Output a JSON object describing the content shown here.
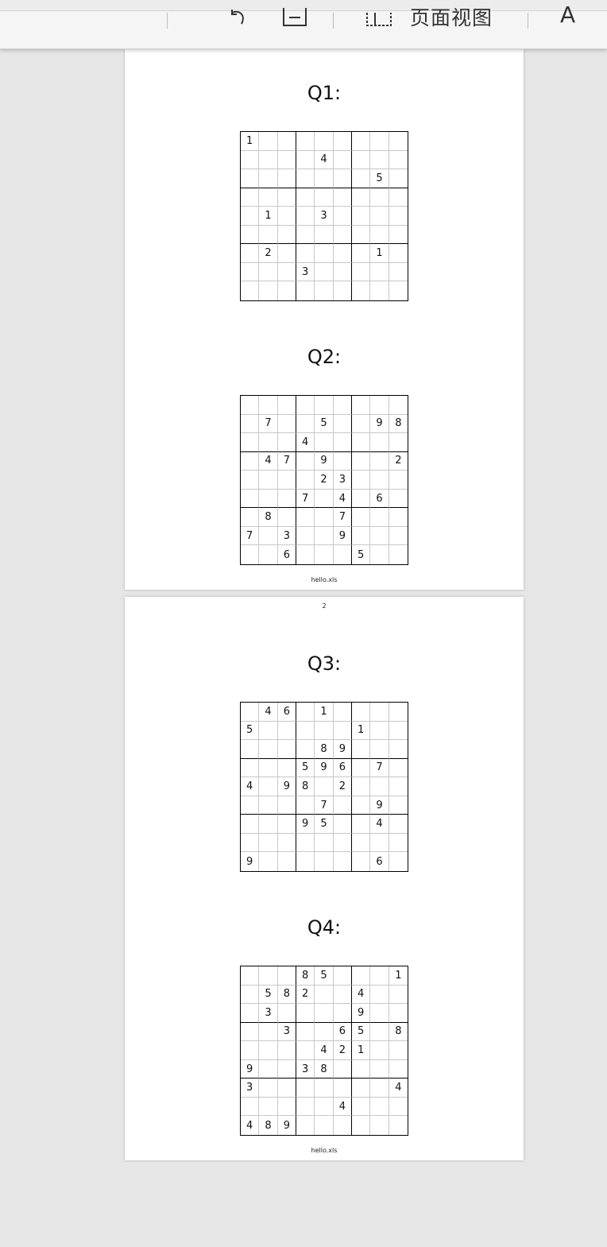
{
  "toolbar": {
    "page_view_label": "页面视图",
    "font_label": "A"
  },
  "page1": {
    "puzzles": [
      {
        "title": "Q1:",
        "grid": [
          [
            "1",
            "",
            "",
            "",
            "",
            "",
            "",
            "",
            ""
          ],
          [
            "",
            "",
            "",
            "",
            "4",
            "",
            "",
            "",
            ""
          ],
          [
            "",
            "",
            "",
            "",
            "",
            "",
            "",
            "5",
            ""
          ],
          [
            "",
            "",
            "",
            "",
            "",
            "",
            "",
            "",
            ""
          ],
          [
            "",
            "1",
            "",
            "",
            "3",
            "",
            "",
            "",
            ""
          ],
          [
            "",
            "",
            "",
            "",
            "",
            "",
            "",
            "",
            ""
          ],
          [
            "",
            "2",
            "",
            "",
            "",
            "",
            "",
            "1",
            ""
          ],
          [
            "",
            "",
            "",
            "3",
            "",
            "",
            "",
            "",
            ""
          ],
          [
            "",
            "",
            "",
            "",
            "",
            "",
            "",
            "",
            ""
          ]
        ]
      },
      {
        "title": "Q2:",
        "grid": [
          [
            "",
            "",
            "",
            "",
            "",
            "",
            "",
            "",
            ""
          ],
          [
            "",
            "7",
            "",
            "",
            "5",
            "",
            "",
            "9",
            "8"
          ],
          [
            "",
            "",
            "",
            "4",
            "",
            "",
            "",
            "",
            ""
          ],
          [
            "",
            "4",
            "7",
            "",
            "9",
            "",
            "",
            "",
            "2"
          ],
          [
            "",
            "",
            "",
            "",
            "2",
            "3",
            "",
            "",
            ""
          ],
          [
            "",
            "",
            "",
            "7",
            "",
            "4",
            "",
            "6",
            ""
          ],
          [
            "",
            "8",
            "",
            "",
            "",
            "7",
            "",
            "",
            ""
          ],
          [
            "7",
            "",
            "3",
            "",
            "",
            "9",
            "",
            "",
            ""
          ],
          [
            "",
            "",
            "6",
            "",
            "",
            "",
            "5",
            "",
            ""
          ]
        ]
      }
    ],
    "footer": "hello.xls"
  },
  "page2": {
    "page_number": "2",
    "puzzles": [
      {
        "title": "Q3:",
        "grid": [
          [
            "",
            "4",
            "6",
            "",
            "1",
            "",
            "",
            "",
            ""
          ],
          [
            "5",
            "",
            "",
            "",
            "",
            "",
            "1",
            "",
            ""
          ],
          [
            "",
            "",
            "",
            "",
            "8",
            "9",
            "",
            "",
            ""
          ],
          [
            "",
            "",
            "",
            "5",
            "9",
            "6",
            "",
            "7",
            ""
          ],
          [
            "4",
            "",
            "9",
            "8",
            "",
            "2",
            "",
            "",
            ""
          ],
          [
            "",
            "",
            "",
            "",
            "7",
            "",
            "",
            "9",
            ""
          ],
          [
            "",
            "",
            "",
            "9",
            "5",
            "",
            "",
            "4",
            ""
          ],
          [
            "",
            "",
            "",
            "",
            "",
            "",
            "",
            "",
            ""
          ],
          [
            "9",
            "",
            "",
            "",
            "",
            "",
            "",
            "6",
            ""
          ]
        ]
      },
      {
        "title": "Q4:",
        "grid": [
          [
            "",
            "",
            "",
            "8",
            "5",
            "",
            "",
            "",
            "1"
          ],
          [
            "",
            "5",
            "8",
            "2",
            "",
            "",
            "4",
            "",
            ""
          ],
          [
            "",
            "3",
            "",
            "",
            "",
            "",
            "9",
            "",
            ""
          ],
          [
            "",
            "",
            "3",
            "",
            "",
            "6",
            "5",
            "",
            "8"
          ],
          [
            "",
            "",
            "",
            "",
            "4",
            "2",
            "1",
            "",
            ""
          ],
          [
            "9",
            "",
            "",
            "3",
            "8",
            "",
            "",
            "",
            ""
          ],
          [
            "3",
            "",
            "",
            "",
            "",
            "",
            "",
            "",
            "4"
          ],
          [
            "",
            "",
            "",
            "",
            "",
            "4",
            "",
            "",
            ""
          ],
          [
            "4",
            "8",
            "9",
            "",
            "",
            "",
            "",
            "",
            ""
          ]
        ]
      }
    ],
    "footer": "hello.xls"
  }
}
